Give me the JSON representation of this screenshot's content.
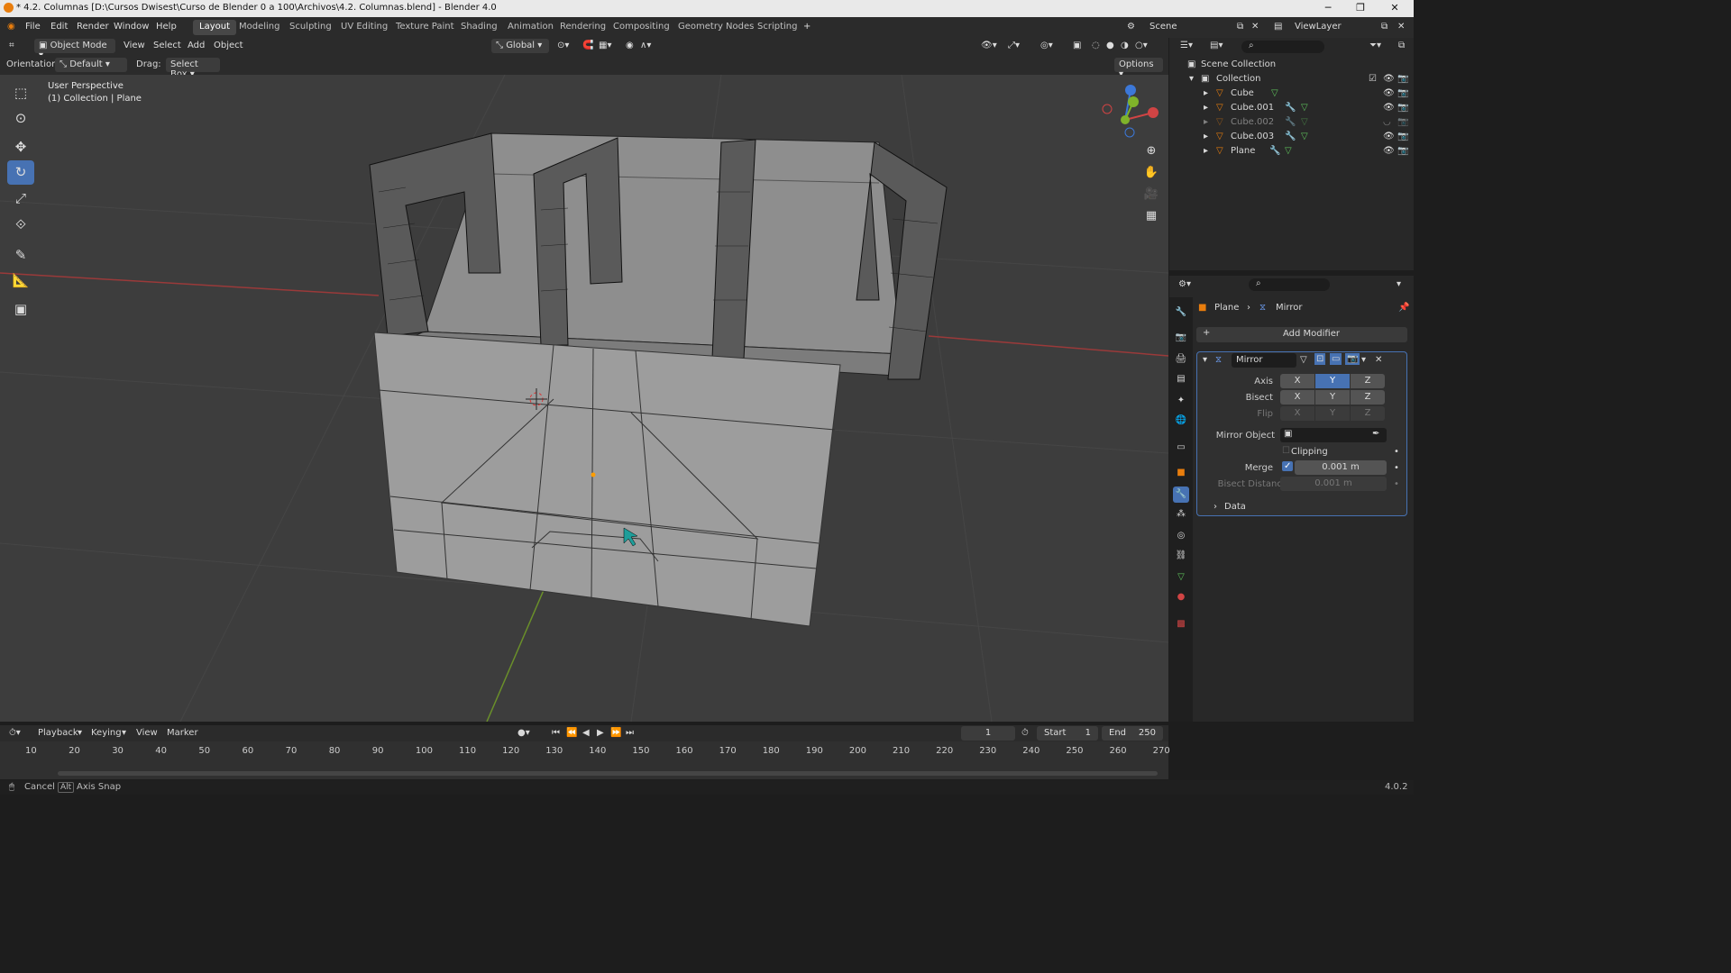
{
  "title": "* 4.2. Columnas [D:\\Cursos Dwisest\\Curso de Blender  0 a 100\\Archivos\\4.2. Columnas.blend] - Blender 4.0",
  "menu": [
    "File",
    "Edit",
    "Render",
    "Window",
    "Help"
  ],
  "workspaces": [
    "Layout",
    "Modeling",
    "Sculpting",
    "UV Editing",
    "Texture Paint",
    "Shading",
    "Animation",
    "Rendering",
    "Compositing",
    "Geometry Nodes",
    "Scripting"
  ],
  "scene": "Scene",
  "view_layer": "ViewLayer",
  "viewport_header": {
    "mode": "Object Mode",
    "menus": [
      "View",
      "Select",
      "Add",
      "Object"
    ],
    "transform": "Global",
    "options": "Options"
  },
  "tool_settings": {
    "orientation_label": "Orientation:",
    "orientation_value": "Default",
    "drag_label": "Drag:",
    "drag_value": "Select Box"
  },
  "viewport_info": {
    "line1": "User Perspective",
    "line2": "(1) Collection | Plane"
  },
  "outliner": {
    "root": "Scene Collection",
    "collection": "Collection",
    "items": [
      {
        "name": "Cube",
        "dim": false
      },
      {
        "name": "Cube.001",
        "dim": false
      },
      {
        "name": "Cube.002",
        "dim": true
      },
      {
        "name": "Cube.003",
        "dim": false
      },
      {
        "name": "Plane",
        "dim": false
      }
    ]
  },
  "properties": {
    "breadcrumb_object": "Plane",
    "breadcrumb_modifier": "Mirror",
    "add_modifier": "Add Modifier",
    "modifier_name": "Mirror",
    "axis_label": "Axis",
    "bisect_label": "Bisect",
    "flip_label": "Flip",
    "axes": [
      "X",
      "Y",
      "Z"
    ],
    "active_axis": "Y",
    "mirror_object_label": "Mirror Object",
    "clipping_label": "Clipping",
    "merge_label": "Merge",
    "merge_value": "0.001 m",
    "bisect_distance_label": "Bisect Distance",
    "bisect_distance_value": "0.001 m",
    "data_label": "Data"
  },
  "timeline": {
    "menus": [
      "Playback",
      "Keying",
      "View",
      "Marker"
    ],
    "current_frame": "1",
    "start_label": "Start",
    "start_value": "1",
    "end_label": "End",
    "end_value": "250",
    "ticks": [
      "10",
      "20",
      "30",
      "40",
      "50",
      "60",
      "70",
      "80",
      "90",
      "100",
      "110",
      "120",
      "130",
      "140",
      "150",
      "160",
      "170",
      "180",
      "190",
      "200",
      "210",
      "220",
      "230",
      "240",
      "250",
      "260",
      "270"
    ]
  },
  "status": {
    "cancel": "Cancel",
    "alt_key": "Alt",
    "axis_snap": "Axis Snap",
    "version": "4.0.2"
  },
  "colors": {
    "accent": "#4772b3",
    "x_axis": "#d04444",
    "y_axis": "#7fb32a",
    "z_axis": "#3c78d8"
  }
}
